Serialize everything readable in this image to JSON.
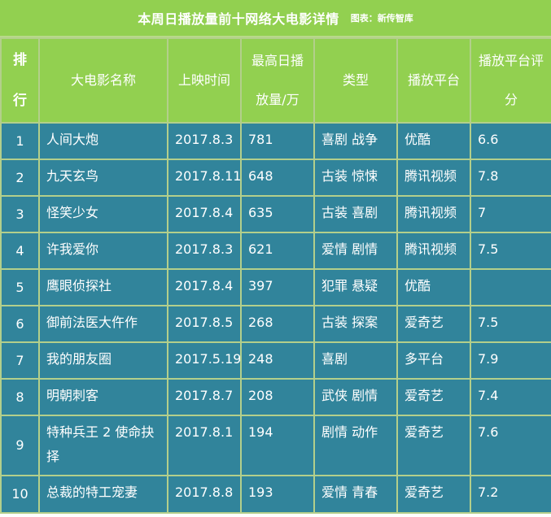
{
  "header": {
    "title": "本周日播放量前十网络大电影详情",
    "source": "图表：新传智库"
  },
  "columns": [
    {
      "line1": "排",
      "line2": "行"
    },
    {
      "line1": "大电影名称",
      "line2": ""
    },
    {
      "line1": "上映时间",
      "line2": ""
    },
    {
      "line1": "最高日播",
      "line2": "放量/万"
    },
    {
      "line1": "类型",
      "line2": ""
    },
    {
      "line1": "播放平台",
      "line2": ""
    },
    {
      "line1": "播放平台评",
      "line2": "分"
    }
  ],
  "rows": [
    {
      "rank": "1",
      "name": "人间大炮",
      "date": "2017.8.3",
      "views": "781",
      "genre": "喜剧  战争",
      "platform": "优酷",
      "score": "6.6"
    },
    {
      "rank": "2",
      "name": "九天玄鸟",
      "date": "2017.8.11",
      "views": "648",
      "genre": "古装  惊悚",
      "platform": "腾讯视频",
      "score": "7.8"
    },
    {
      "rank": "3",
      "name": "怪笑少女",
      "date": "2017.8.4",
      "views": "635",
      "genre": "古装  喜剧",
      "platform": "腾讯视频",
      "score": "7"
    },
    {
      "rank": "4",
      "name": "许我爱你",
      "date": "2017.8.3",
      "views": "621",
      "genre": "爱情  剧情",
      "platform": "腾讯视频",
      "score": "7.5"
    },
    {
      "rank": "5",
      "name": "鹰眼侦探社",
      "date": "2017.8.4",
      "views": "397",
      "genre": "犯罪  悬疑",
      "platform": "优酷",
      "score": ""
    },
    {
      "rank": "6",
      "name": "御前法医大仵作",
      "date": "2017.8.5",
      "views": "268",
      "genre": "古装  探案",
      "platform": "爱奇艺",
      "score": "7.5"
    },
    {
      "rank": "7",
      "name": "我的朋友圈",
      "date": "2017.5.19",
      "views": "248",
      "genre": "喜剧",
      "platform": "多平台",
      "score": "7.9"
    },
    {
      "rank": "8",
      "name": "明朝刺客",
      "date": "2017.8.7",
      "views": "208",
      "genre": "武侠  剧情",
      "platform": "爱奇艺",
      "score": "7.4"
    },
    {
      "rank": "9",
      "name": "特种兵王 2 使命抉择",
      "date": "2017.8.1",
      "views": "194",
      "genre": "剧情  动作",
      "platform": "爱奇艺",
      "score": "7.6"
    },
    {
      "rank": "10",
      "name": "总裁的特工宠妻",
      "date": "2017.8.8",
      "views": "193",
      "genre": "爱情  青春",
      "platform": "爱奇艺",
      "score": "7.2"
    }
  ]
}
